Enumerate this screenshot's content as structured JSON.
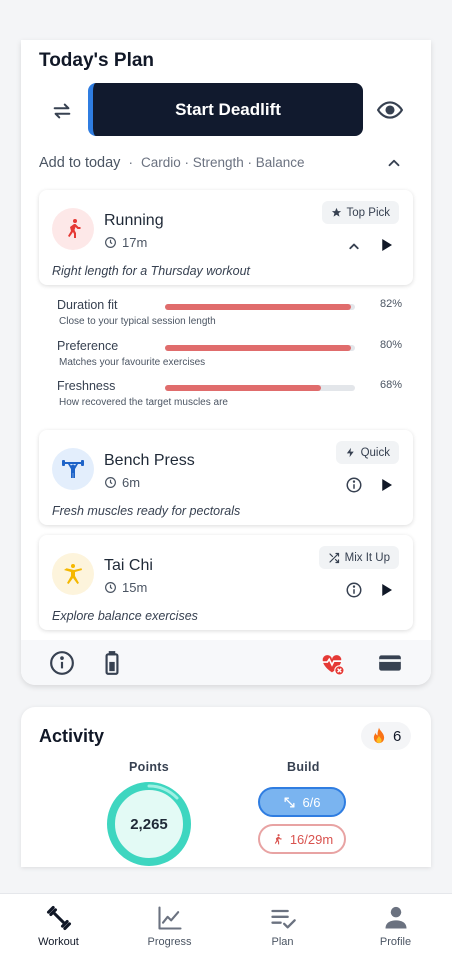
{
  "plan": {
    "title": "Today's Plan",
    "start_button": "Start Deadlift",
    "add_label": "Add to today",
    "add_separator": "·",
    "add_categories": "Cardio · Strength · Balance",
    "exercises": [
      {
        "name": "Running",
        "duration": "17m",
        "badge": "Top Pick",
        "badge_icon": "star-icon",
        "note": "Right length for a Thursday workout",
        "icon": "running-icon",
        "color": "#e53935"
      },
      {
        "name": "Bench Press",
        "duration": "6m",
        "badge": "Quick",
        "badge_icon": "bolt-icon",
        "note": "Fresh muscles ready for pectorals",
        "icon": "weightlifter-icon",
        "color": "#1e63c8"
      },
      {
        "name": "Tai Chi",
        "duration": "15m",
        "badge": "Mix It Up",
        "badge_icon": "shuffle-icon",
        "note": "Explore balance exercises",
        "icon": "tai-chi-icon",
        "color": "#f5b800"
      }
    ],
    "metrics": [
      {
        "label": "Duration fit",
        "desc": "Close to your typical session length",
        "percent": "82%",
        "value": 0.98
      },
      {
        "label": "Preference",
        "desc": "Matches your favourite exercises",
        "percent": "80%",
        "value": 0.98
      },
      {
        "label": "Freshness",
        "desc": "How recovered the target muscles are",
        "percent": "68%",
        "value": 0.82
      }
    ]
  },
  "activity": {
    "title": "Activity",
    "streak": "6",
    "points_label": "Points",
    "points_value": "2,265",
    "build_label": "Build",
    "build_sets": "6/6",
    "build_minutes": "16/29m"
  },
  "tabs": [
    {
      "label": "Workout",
      "icon": "dumbbell-icon"
    },
    {
      "label": "Progress",
      "icon": "chart-icon"
    },
    {
      "label": "Plan",
      "icon": "checklist-icon"
    },
    {
      "label": "Profile",
      "icon": "person-icon"
    }
  ],
  "colors": {
    "accent": "#2f7de1",
    "primary_button": "#111a2e",
    "bar_fill": "#e06c6c",
    "ring": "#3ed6c0",
    "warning": "#e53935"
  }
}
